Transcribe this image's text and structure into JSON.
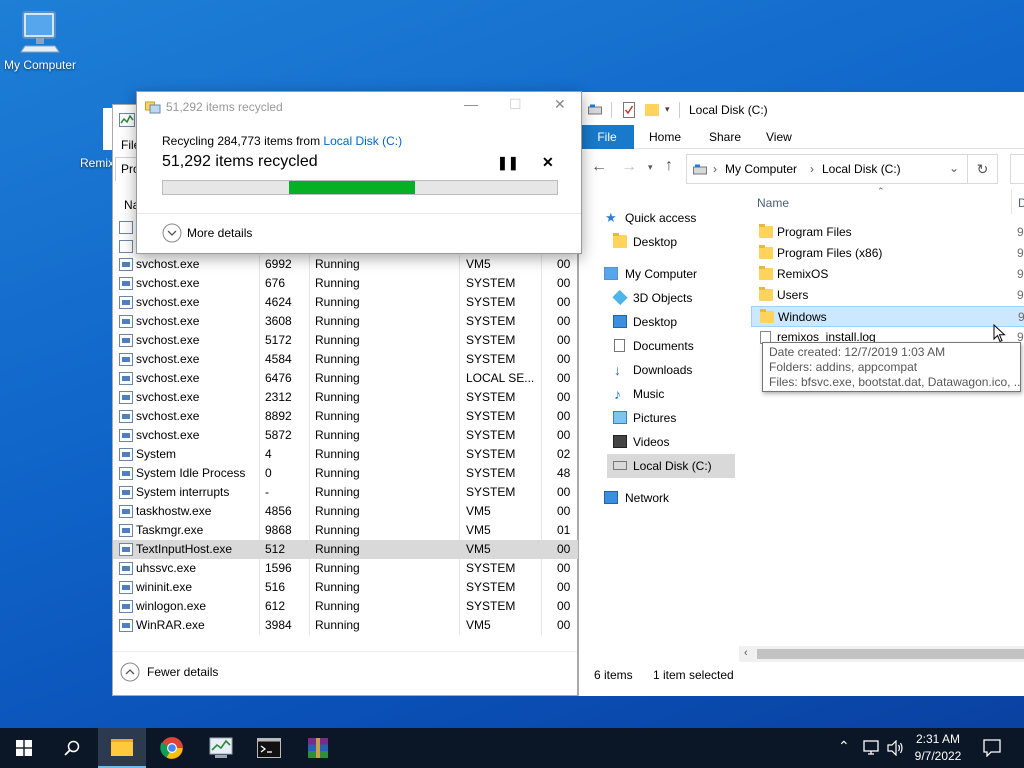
{
  "desktop": {
    "icons": [
      {
        "label": "My Computer"
      },
      {
        "label": "Remix"
      }
    ]
  },
  "recycle_dialog": {
    "title": "51,292 items recycled",
    "source_prefix": "Recycling 284,773 items from",
    "source_link": "Local Disk (C:)",
    "status": "51,292 items recycled",
    "progress_fraction_start": 0.32,
    "progress_fraction_end": 0.64,
    "more_details": "More details",
    "progress_color": "#06b025"
  },
  "task_manager": {
    "file_menu": "File",
    "tab_partial": "Pro",
    "name_header_partial": "Na",
    "processes": [
      {
        "name": "svchost.exe",
        "pid": "6992",
        "status": "Running",
        "user": "VM5",
        "cpu": "00"
      },
      {
        "name": "svchost.exe",
        "pid": "676",
        "status": "Running",
        "user": "SYSTEM",
        "cpu": "00"
      },
      {
        "name": "svchost.exe",
        "pid": "4624",
        "status": "Running",
        "user": "SYSTEM",
        "cpu": "00"
      },
      {
        "name": "svchost.exe",
        "pid": "3608",
        "status": "Running",
        "user": "SYSTEM",
        "cpu": "00"
      },
      {
        "name": "svchost.exe",
        "pid": "5172",
        "status": "Running",
        "user": "SYSTEM",
        "cpu": "00"
      },
      {
        "name": "svchost.exe",
        "pid": "4584",
        "status": "Running",
        "user": "SYSTEM",
        "cpu": "00"
      },
      {
        "name": "svchost.exe",
        "pid": "6476",
        "status": "Running",
        "user": "LOCAL SE...",
        "cpu": "00"
      },
      {
        "name": "svchost.exe",
        "pid": "2312",
        "status": "Running",
        "user": "SYSTEM",
        "cpu": "00"
      },
      {
        "name": "svchost.exe",
        "pid": "8892",
        "status": "Running",
        "user": "SYSTEM",
        "cpu": "00"
      },
      {
        "name": "svchost.exe",
        "pid": "5872",
        "status": "Running",
        "user": "SYSTEM",
        "cpu": "00"
      },
      {
        "name": "System",
        "pid": "4",
        "status": "Running",
        "user": "SYSTEM",
        "cpu": "02"
      },
      {
        "name": "System Idle Process",
        "pid": "0",
        "status": "Running",
        "user": "SYSTEM",
        "cpu": "48"
      },
      {
        "name": "System interrupts",
        "pid": "-",
        "status": "Running",
        "user": "SYSTEM",
        "cpu": "00"
      },
      {
        "name": "taskhostw.exe",
        "pid": "4856",
        "status": "Running",
        "user": "VM5",
        "cpu": "00"
      },
      {
        "name": "Taskmgr.exe",
        "pid": "9868",
        "status": "Running",
        "user": "VM5",
        "cpu": "01"
      },
      {
        "name": "TextInputHost.exe",
        "pid": "512",
        "status": "Running",
        "user": "VM5",
        "cpu": "00"
      },
      {
        "name": "uhssvc.exe",
        "pid": "1596",
        "status": "Running",
        "user": "SYSTEM",
        "cpu": "00"
      },
      {
        "name": "wininit.exe",
        "pid": "516",
        "status": "Running",
        "user": "SYSTEM",
        "cpu": "00"
      },
      {
        "name": "winlogon.exe",
        "pid": "612",
        "status": "Running",
        "user": "SYSTEM",
        "cpu": "00"
      },
      {
        "name": "WinRAR.exe",
        "pid": "3984",
        "status": "Running",
        "user": "VM5",
        "cpu": "00"
      }
    ],
    "fewer_details": "Fewer details"
  },
  "explorer": {
    "title": "Local Disk (C:)",
    "ribbon_tabs": [
      "File",
      "Home",
      "Share",
      "View"
    ],
    "breadcrumb": [
      "My Computer",
      "Local Disk (C:)"
    ],
    "column_name": "Name",
    "column_date_partial": "D",
    "nav": {
      "quick_access": "Quick access",
      "desktop_qa": "Desktop",
      "my_computer": "My Computer",
      "objects3d": "3D Objects",
      "desktop": "Desktop",
      "documents": "Documents",
      "downloads": "Downloads",
      "music": "Music",
      "pictures": "Pictures",
      "videos": "Videos",
      "local_disk": "Local Disk (C:)",
      "network": "Network"
    },
    "files": [
      {
        "name": "Program Files",
        "date_partial": "9,"
      },
      {
        "name": "Program Files (x86)",
        "date_partial": "9,"
      },
      {
        "name": "RemixOS",
        "date_partial": "9,"
      },
      {
        "name": "Users",
        "date_partial": "9,"
      },
      {
        "name": "Windows",
        "date_partial": "9,"
      },
      {
        "name": "remixos_install.log",
        "date_partial": "9,"
      }
    ],
    "status_items": "6 items",
    "status_selected": "1 item selected",
    "selection_color": "#cce8ff"
  },
  "tooltip": {
    "line1": "Date created: 12/7/2019 1:03 AM",
    "line2": "Folders: addins, appcompat",
    "line3": "Files: bfsvc.exe, bootstat.dat, Datawagon.ico, ..."
  },
  "taskbar": {
    "time": "2:31 AM",
    "date": "9/7/2022"
  }
}
